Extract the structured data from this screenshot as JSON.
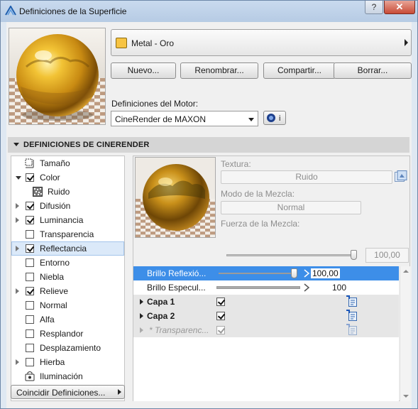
{
  "window": {
    "title": "Definiciones de la Superficie",
    "help_label": "?",
    "close_label": "✕",
    "app_icon": "archicad-icon"
  },
  "surface": {
    "name": "Metal - Oro",
    "swatch_color": "#f7c443"
  },
  "buttons": {
    "new": "Nuevo...",
    "rename": "Renombrar...",
    "share": "Compartir...",
    "delete": "Borrar..."
  },
  "engine": {
    "label": "Definiciones del Motor:",
    "selected": "CineRender de MAXON",
    "info_label": "i"
  },
  "section": {
    "title": "DEFINICIONES DE CINERENDER"
  },
  "channels": [
    {
      "label": "Tamaño"
    },
    {
      "label": "Color"
    },
    {
      "label": "Ruido"
    },
    {
      "label": "Difusión"
    },
    {
      "label": "Luminancia"
    },
    {
      "label": "Transparencia"
    },
    {
      "label": "Reflectancia"
    },
    {
      "label": "Entorno"
    },
    {
      "label": "Niebla"
    },
    {
      "label": "Relieve"
    },
    {
      "label": "Normal"
    },
    {
      "label": "Alfa"
    },
    {
      "label": "Resplandor"
    },
    {
      "label": "Desplazamiento"
    },
    {
      "label": "Hierba"
    },
    {
      "label": "Iluminación"
    }
  ],
  "match_button": "Coincidir Definiciones...",
  "texture": {
    "label": "Textura:",
    "value": "Ruido"
  },
  "blend_mode": {
    "label": "Modo de la Mezcla:",
    "value": "Normal"
  },
  "blend_strength": {
    "label": "Fuerza de la Mezcla:",
    "value": "100,00",
    "level_percent": 100
  },
  "params": [
    {
      "label": "Brillo Reflexió...",
      "value": "100,00",
      "level_percent": 100
    },
    {
      "label": "Brillo Especul...",
      "value": "100",
      "level_percent": 100
    },
    {
      "label": "Capa 1"
    },
    {
      "label": "Capa 2"
    },
    {
      "label": "* Transparenc..."
    }
  ],
  "colors": {
    "selection": "#3d8ee8",
    "gold": "#f7c443"
  }
}
